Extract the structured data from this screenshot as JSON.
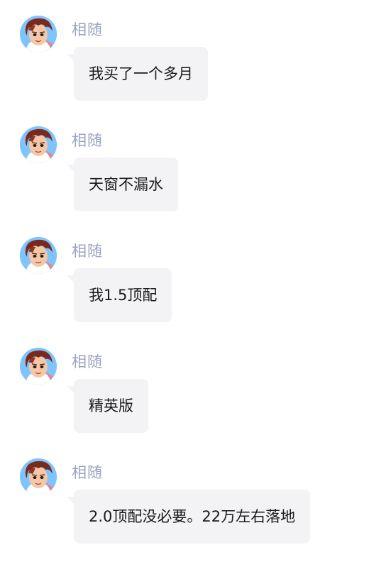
{
  "messages": [
    {
      "sender": "相随",
      "text": "我买了一个多月",
      "avatar": "cartoon-boy-avatar"
    },
    {
      "sender": "相随",
      "text": "天窗不漏水",
      "avatar": "cartoon-boy-avatar"
    },
    {
      "sender": "相随",
      "text": "我1.5顶配",
      "avatar": "cartoon-boy-avatar"
    },
    {
      "sender": "相随",
      "text": "精英版",
      "avatar": "cartoon-boy-avatar"
    },
    {
      "sender": "相随",
      "text": "2.0顶配没必要。22万左右落地",
      "avatar": "cartoon-boy-avatar"
    }
  ],
  "colors": {
    "sender_name": "#9aa3c0",
    "bubble_bg": "#f3f3f5",
    "message_text": "#1a1a1a",
    "background": "#ffffff"
  }
}
